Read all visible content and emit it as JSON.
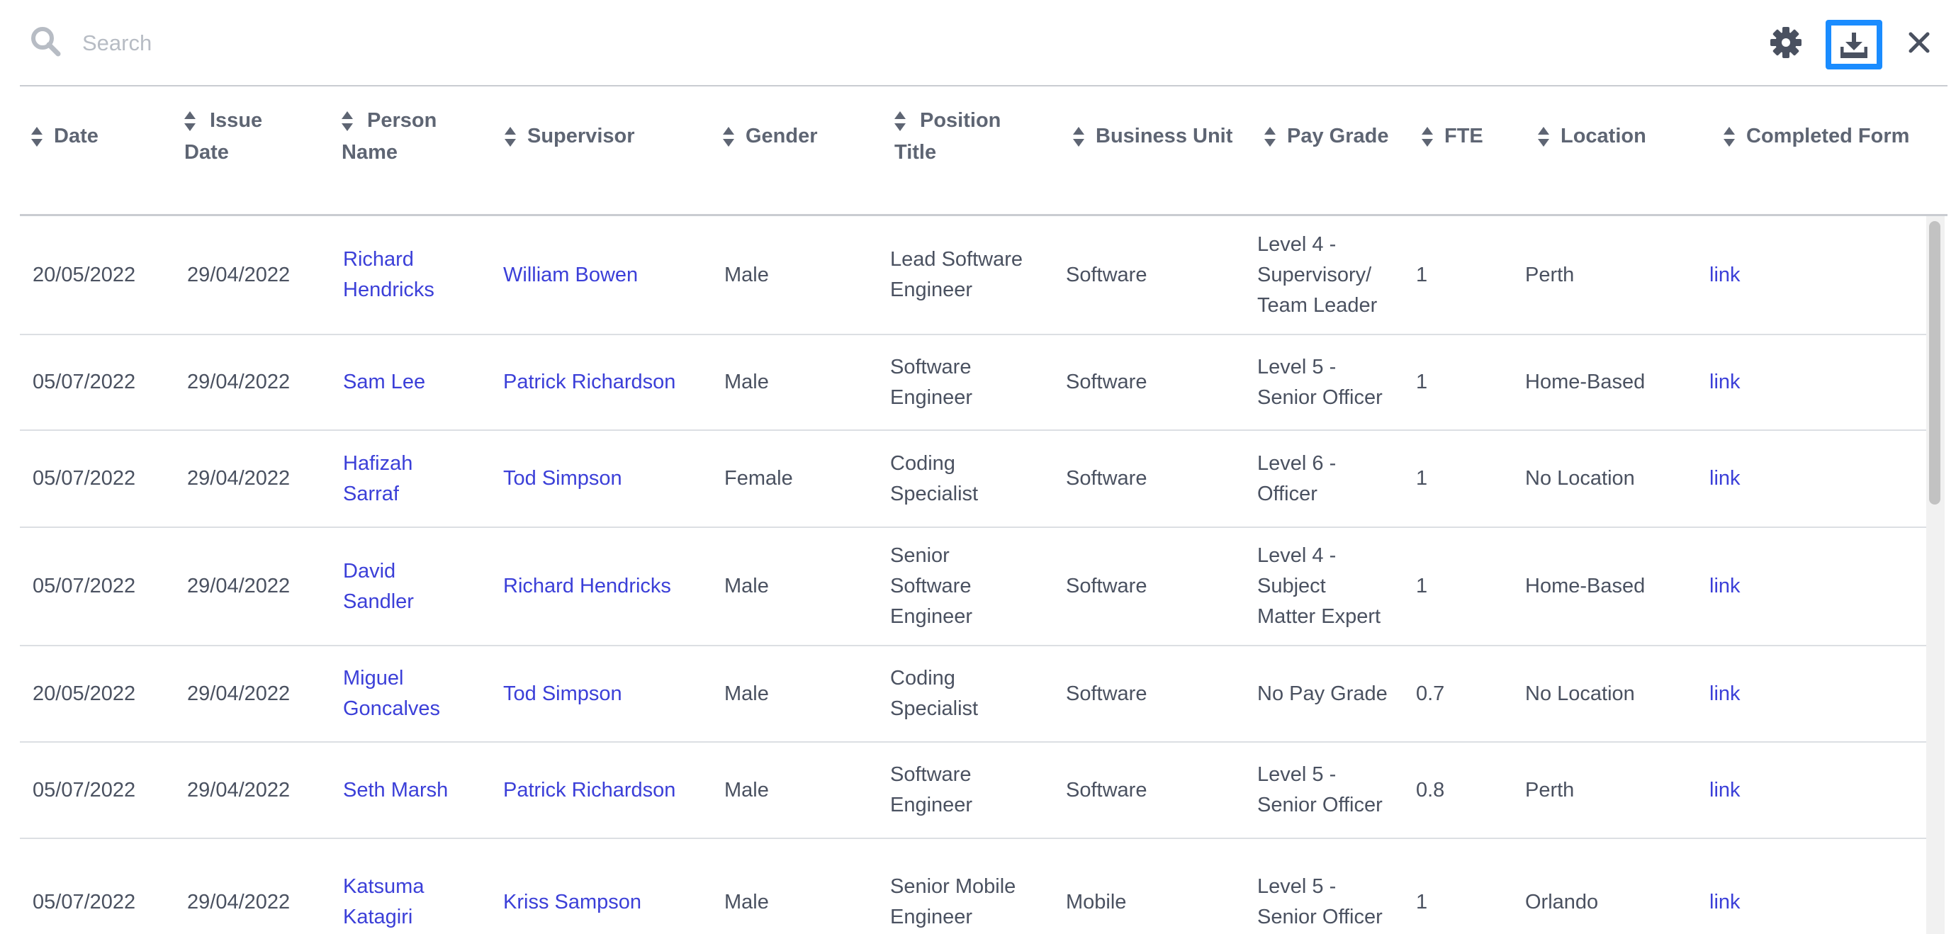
{
  "search": {
    "placeholder": "Search",
    "value": ""
  },
  "toolbar": {
    "settings_icon": "gear-icon",
    "download_icon": "download-icon",
    "close_icon": "close-icon",
    "download_highlight_color": "#1a8cff"
  },
  "columns": [
    {
      "key": "date",
      "label": "Date"
    },
    {
      "key": "issue_date",
      "label_line1": "Issue",
      "label_line2": "Date"
    },
    {
      "key": "person_name",
      "label_line1": "Person",
      "label_line2": "Name"
    },
    {
      "key": "supervisor",
      "label": "Supervisor"
    },
    {
      "key": "gender",
      "label": "Gender"
    },
    {
      "key": "position_title",
      "label_line1": "Position",
      "label_line2": "Title"
    },
    {
      "key": "business_unit",
      "label": "Business Unit"
    },
    {
      "key": "pay_grade",
      "label": "Pay Grade"
    },
    {
      "key": "fte",
      "label": "FTE"
    },
    {
      "key": "location",
      "label": "Location"
    },
    {
      "key": "completed_form",
      "label": "Completed Form"
    }
  ],
  "rows": [
    {
      "date": "20/05/2022",
      "issue_date": "29/04/2022",
      "person_name": [
        "Richard",
        "Hendricks"
      ],
      "supervisor": "William Bowen",
      "gender": "Male",
      "position_title": [
        "Lead Software",
        "Engineer"
      ],
      "business_unit": "Software",
      "pay_grade": [
        "Level 4 -",
        "Supervisory/",
        "Team Leader"
      ],
      "fte": "1",
      "location": "Perth",
      "completed_form": "link"
    },
    {
      "date": "05/07/2022",
      "issue_date": "29/04/2022",
      "person_name": [
        "Sam Lee"
      ],
      "supervisor": "Patrick Richardson",
      "gender": "Male",
      "position_title": [
        "Software",
        "Engineer"
      ],
      "business_unit": "Software",
      "pay_grade": [
        "Level 5 -",
        "Senior Officer"
      ],
      "fte": "1",
      "location": "Home-Based",
      "completed_form": "link"
    },
    {
      "date": "05/07/2022",
      "issue_date": "29/04/2022",
      "person_name": [
        "Hafizah",
        "Sarraf"
      ],
      "supervisor": "Tod Simpson",
      "gender": "Female",
      "position_title": [
        "Coding",
        "Specialist"
      ],
      "business_unit": "Software",
      "pay_grade": [
        "Level 6 -",
        "Officer"
      ],
      "fte": "1",
      "location": "No Location",
      "completed_form": "link"
    },
    {
      "date": "05/07/2022",
      "issue_date": "29/04/2022",
      "person_name": [
        "David",
        "Sandler"
      ],
      "supervisor": "Richard Hendricks",
      "gender": "Male",
      "position_title": [
        "Senior",
        "Software",
        "Engineer"
      ],
      "business_unit": "Software",
      "pay_grade": [
        "Level 4 -",
        "Subject",
        "Matter Expert"
      ],
      "fte": "1",
      "location": "Home-Based",
      "completed_form": "link"
    },
    {
      "date": "20/05/2022",
      "issue_date": "29/04/2022",
      "person_name": [
        "Miguel",
        "Goncalves"
      ],
      "supervisor": "Tod Simpson",
      "gender": "Male",
      "position_title": [
        "Coding",
        "Specialist"
      ],
      "business_unit": "Software",
      "pay_grade": [
        "No Pay Grade"
      ],
      "fte": "0.7",
      "location": "No Location",
      "completed_form": "link"
    },
    {
      "date": "05/07/2022",
      "issue_date": "29/04/2022",
      "person_name": [
        "Seth Marsh"
      ],
      "supervisor": "Patrick Richardson",
      "gender": "Male",
      "position_title": [
        "Software",
        "Engineer"
      ],
      "business_unit": "Software",
      "pay_grade": [
        "Level 5 -",
        "Senior Officer"
      ],
      "fte": "0.8",
      "location": "Perth",
      "completed_form": "link"
    },
    {
      "date": "05/07/2022",
      "issue_date": "29/04/2022",
      "person_name": [
        "Katsuma",
        "Katagiri"
      ],
      "supervisor": "Kriss Sampson",
      "gender": "Male",
      "position_title": [
        "Senior Mobile",
        "Engineer"
      ],
      "business_unit": "Mobile",
      "pay_grade": [
        "Level 5 -",
        "Senior Officer"
      ],
      "fte": "1",
      "location": "Orlando",
      "completed_form": "link"
    }
  ],
  "colors": {
    "link": "#3b3fd8",
    "text": "#4a5160",
    "header_text": "#5e6573",
    "rule": "#c9ccd1"
  }
}
